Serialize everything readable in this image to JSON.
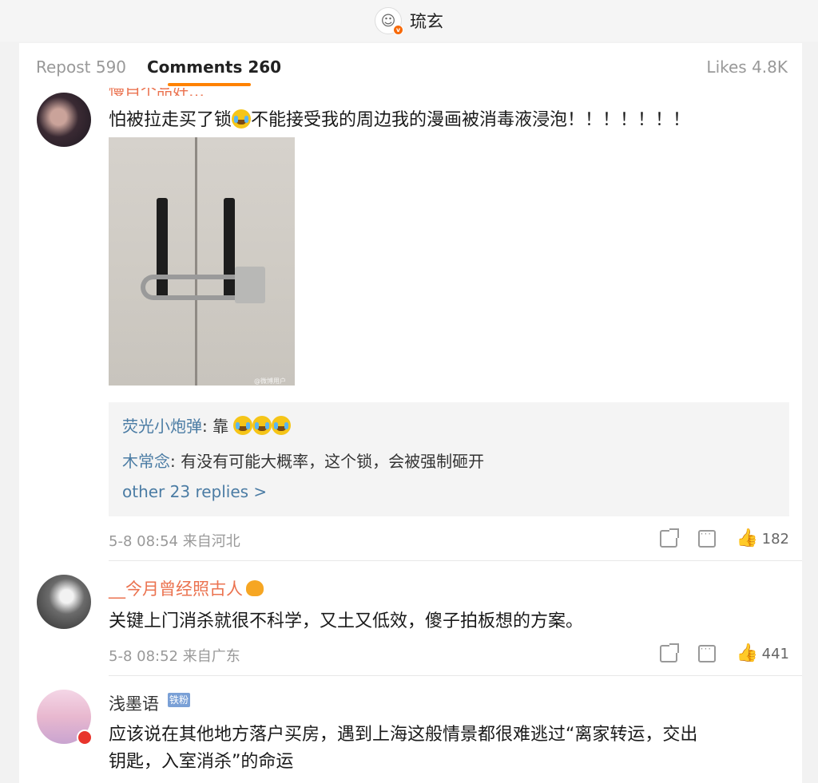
{
  "header": {
    "title": "琉玄",
    "logo_icon": "avatar-logo"
  },
  "tabs": {
    "repost": "Repost 590",
    "comments": "Comments 260",
    "likes": "Likes 4.8K"
  },
  "comments": [
    {
      "username_partial": "慢自个品好…",
      "text": "怕被拉走买了锁",
      "text_after_emoji": "不能接受我的周边我的漫画被消毒液浸泡！！！！！！！",
      "photo_watermark": "@微博用户",
      "replies": [
        {
          "name": "荧光小炮弹",
          "sep": ":",
          "text": " 靠"
        },
        {
          "name": "木常念",
          "sep": ":",
          "text": " 有没有可能大概率，这个锁，会被强制砸开"
        }
      ],
      "more_replies": "other 23 replies >",
      "meta": "5-8 08:54 来自河北",
      "likes": "182"
    },
    {
      "username": "__今月曾经照古人",
      "text": "关键上门消杀就很不科学，又土又低效，傻子拍板想的方案。",
      "meta": "5-8 08:52 来自广东",
      "likes": "441"
    },
    {
      "username": "浅墨语",
      "fan_badge": "铁粉",
      "text_line1": "应该说在其他地方落户买房，遇到上海这般情景都很难逃过“离家转运，交出",
      "text_line2": "钥匙，入室消杀”的命运"
    }
  ],
  "colors": {
    "accent": "#ff8200",
    "username": "#eb7350",
    "reply_name": "#4b7ca4"
  }
}
